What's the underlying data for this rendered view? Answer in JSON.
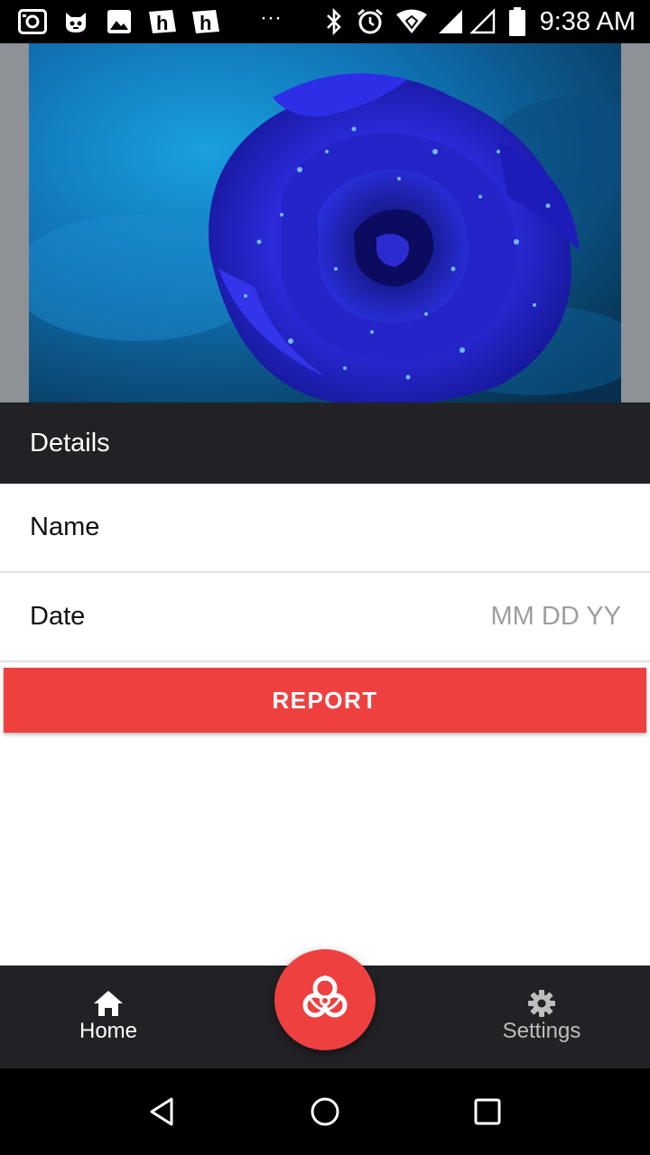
{
  "status_bar": {
    "time": "9:38 AM",
    "left_icons": [
      "camera-notification-icon",
      "cat-app-icon",
      "image-icon",
      "h-app-icon",
      "h-app-icon",
      "more-dots-icon"
    ],
    "right_icons": [
      "bluetooth-icon",
      "alarm-icon",
      "wifi-icon",
      "signal-icon",
      "signal-empty-icon",
      "battery-icon"
    ],
    "more_dots": "···"
  },
  "hero": {
    "icon": "blue-rose-photo"
  },
  "details": {
    "title": "Details"
  },
  "form": {
    "name_label": "Name",
    "name_value": "",
    "date_label": "Date",
    "date_placeholder": "MM DD YY",
    "date_value": ""
  },
  "report_button": {
    "label": "REPORT"
  },
  "bottom_nav": {
    "home_label": "Home",
    "settings_label": "Settings",
    "fab_icon": "biohazard-icon"
  },
  "colors": {
    "accent": "#ef4040",
    "dark_bar": "#222226",
    "status_bar": "#000000"
  }
}
